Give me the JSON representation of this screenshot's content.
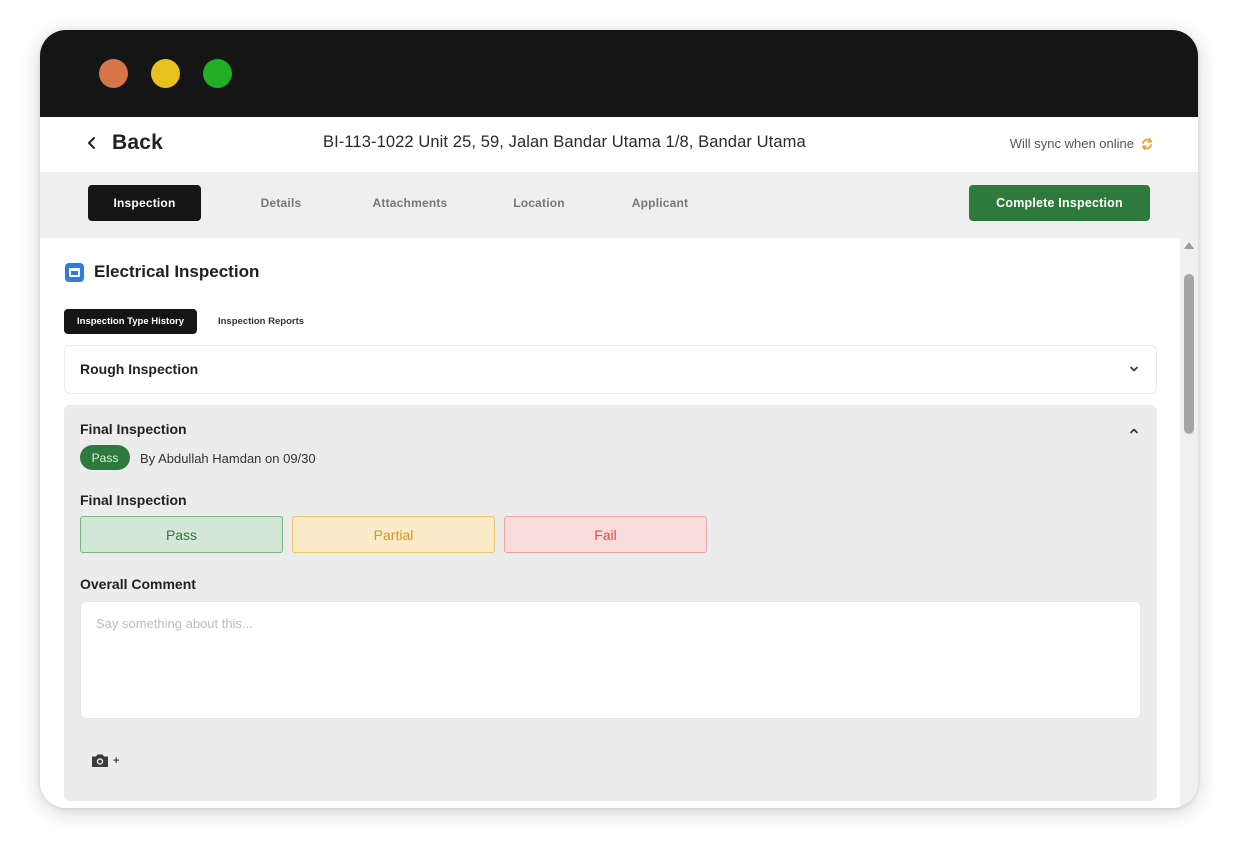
{
  "header": {
    "back_label": "Back",
    "permit_title": "BI-113-1022 Unit 25, 59, Jalan Bandar Utama 1/8, Bandar Utama",
    "sync_status": "Will sync when online"
  },
  "tabs": [
    {
      "label": "Inspection",
      "active": true
    },
    {
      "label": "Details",
      "active": false
    },
    {
      "label": "Attachments",
      "active": false
    },
    {
      "label": "Location",
      "active": false
    },
    {
      "label": "Applicant",
      "active": false
    }
  ],
  "complete_button": "Complete Inspection",
  "section": {
    "title": "Electrical Inspection",
    "icon": "calendar-icon"
  },
  "subtabs": [
    {
      "label": "Inspection Type History",
      "active": true
    },
    {
      "label": "Inspection Reports",
      "active": false
    }
  ],
  "rough": {
    "title": "Rough Inspection",
    "expanded": false
  },
  "final": {
    "title": "Final Inspection",
    "expanded": true,
    "status_badge": "Pass",
    "byline": "By Abdullah Hamdan on 09/30",
    "result_label": "Final Inspection",
    "options": [
      "Pass",
      "Partial",
      "Fail"
    ],
    "comment_label": "Overall Comment",
    "comment_placeholder": "Say something about this...",
    "comment_value": "",
    "camera_plus": "+"
  },
  "colors": {
    "titlebar": "#151515",
    "accent_green": "#2e7a3c",
    "partial_orange": "#d9951a",
    "fail_red": "#e04e4e",
    "sync_icon": "#f0a321",
    "section_icon_blue": "#2f7be0"
  }
}
